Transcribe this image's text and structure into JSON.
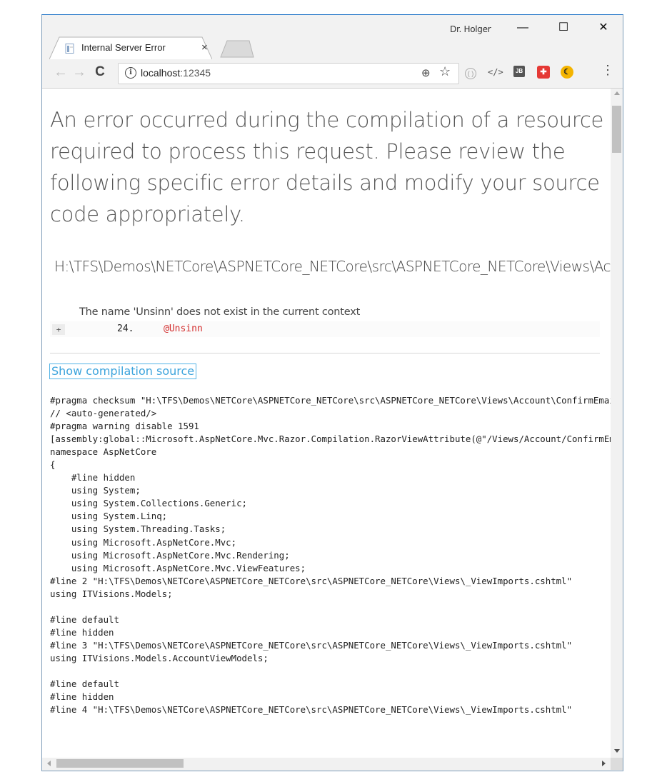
{
  "window": {
    "user_label": "Dr. Holger",
    "minimize": "—",
    "maximize": "☐",
    "close": "✕"
  },
  "tab": {
    "title": "Internal Server Error",
    "close": "×"
  },
  "toolbar": {
    "back": "←",
    "forward": "→",
    "reload": "C",
    "info_icon": "i",
    "url_host": "localhost",
    "url_port": ":12345",
    "zoom_icon": "⊕",
    "star_icon": "☆",
    "menu": "⋮",
    "extensions": [
      {
        "icon": "circle-extension-icon",
        "glyph": "( )"
      },
      {
        "icon": "code-extension-icon",
        "glyph": "</>"
      },
      {
        "icon": "jetbrains-extension-icon",
        "glyph": "JB"
      },
      {
        "icon": "red-extension-icon",
        "glyph": "✚"
      },
      {
        "icon": "moon-extension-icon",
        "glyph": "☾"
      }
    ]
  },
  "page": {
    "heading": "An error occurred during the compilation of a resource required to process this request. Please review the following specific error details and modify your source code appropriately.",
    "file_path": "H:\\TFS\\Demos\\NETCore\\ASPNETCore_NETCore\\src\\ASPNETCore_NETCore\\Views\\Account\\ConfirmEmail.cshtml",
    "error_message": "The name 'Unsinn' does not exist in the current context",
    "expand": "+",
    "line_number": "24.",
    "line_code": "@Unsinn",
    "show_source": "Show compilation source",
    "code": "#pragma checksum \"H:\\TFS\\Demos\\NETCore\\ASPNETCore_NETCore\\src\\ASPNETCore_NETCore\\Views\\Account\\ConfirmEmail.cshtml\"\n// <auto-generated/>\n#pragma warning disable 1591\n[assembly:global::Microsoft.AspNetCore.Mvc.Razor.Compilation.RazorViewAttribute(@\"/Views/Account/ConfirmEmail.cshtml\")]\nnamespace AspNetCore\n{\n    #line hidden\n    using System;\n    using System.Collections.Generic;\n    using System.Linq;\n    using System.Threading.Tasks;\n    using Microsoft.AspNetCore.Mvc;\n    using Microsoft.AspNetCore.Mvc.Rendering;\n    using Microsoft.AspNetCore.Mvc.ViewFeatures;\n#line 2 \"H:\\TFS\\Demos\\NETCore\\ASPNETCore_NETCore\\src\\ASPNETCore_NETCore\\Views\\_ViewImports.cshtml\"\nusing ITVisions.Models;\n\n#line default\n#line hidden\n#line 3 \"H:\\TFS\\Demos\\NETCore\\ASPNETCore_NETCore\\src\\ASPNETCore_NETCore\\Views\\_ViewImports.cshtml\"\nusing ITVisions.Models.AccountViewModels;\n\n#line default\n#line hidden\n#line 4 \"H:\\TFS\\Demos\\NETCore\\ASPNETCore_NETCore\\src\\ASPNETCore_NETCore\\Views\\_ViewImports.cshtml\""
  },
  "colors": {
    "accent_link": "#3ba3dc",
    "error_code": "#d32f2f",
    "window_border": "#1e72c7"
  }
}
